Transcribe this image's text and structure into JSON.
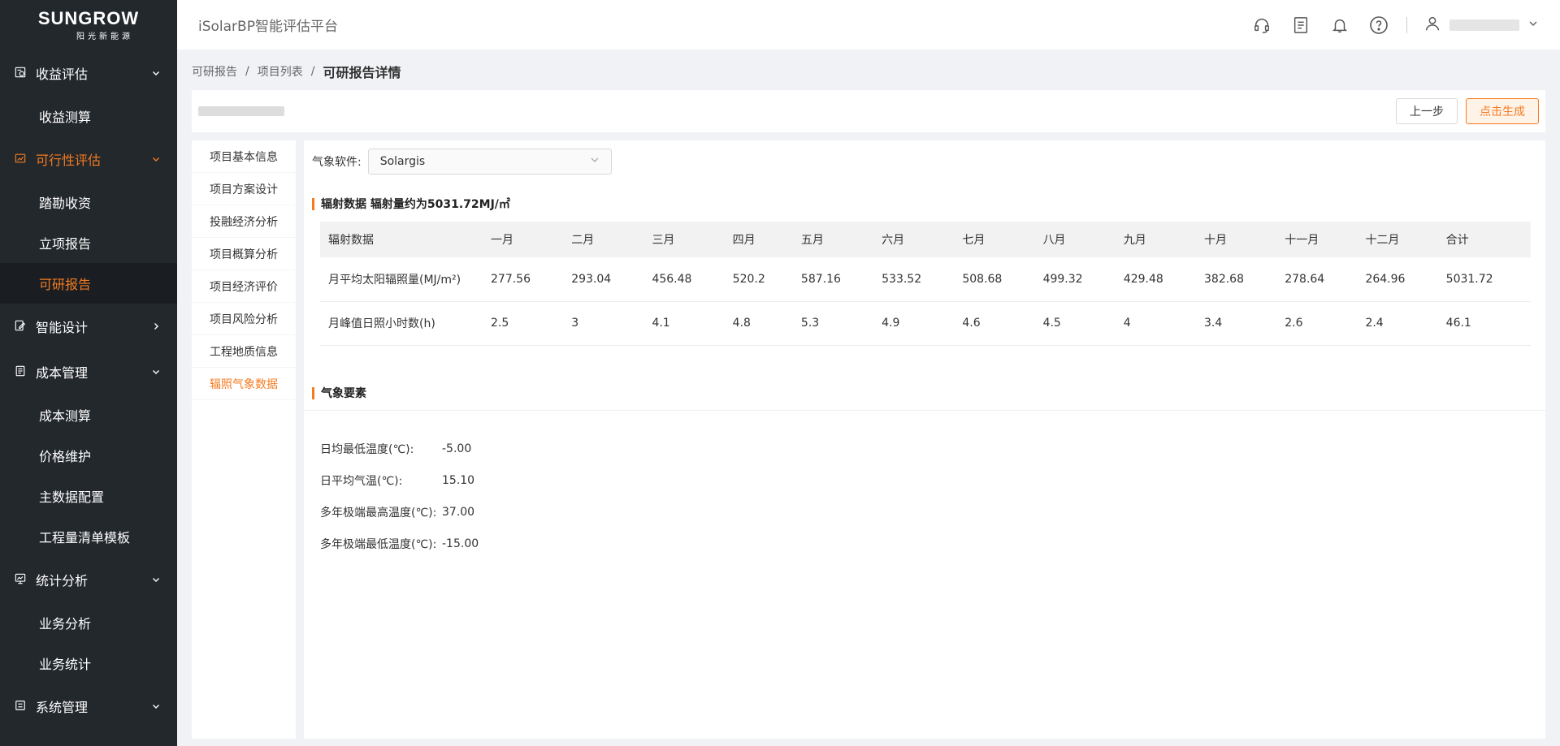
{
  "logo": {
    "brand": "SUNGROW",
    "sub": "阳光新能源"
  },
  "header": {
    "app_title": "iSolarBP智能评估平台"
  },
  "sidebar": {
    "groups": [
      {
        "label": "收益评估",
        "icon": "revenue-icon",
        "arrow": "down",
        "items": [
          "收益测算"
        ]
      },
      {
        "label": "可行性评估",
        "icon": "feasibility-icon",
        "arrow": "down",
        "active": true,
        "items": [
          "踏勘收资",
          "立项报告",
          "可研报告"
        ]
      },
      {
        "label": "智能设计",
        "icon": "design-icon",
        "arrow": "right",
        "items": []
      },
      {
        "label": "成本管理",
        "icon": "cost-icon",
        "arrow": "down",
        "items": [
          "成本测算",
          "价格维护",
          "主数据配置",
          "工程量清单模板"
        ]
      },
      {
        "label": "统计分析",
        "icon": "stats-icon",
        "arrow": "down",
        "items": [
          "业务分析",
          "业务统计"
        ]
      },
      {
        "label": "系统管理",
        "icon": "system-icon",
        "arrow": "down",
        "items": []
      }
    ],
    "selected_item": "可研报告"
  },
  "breadcrumb": {
    "level1": "可研报告",
    "level2": "项目列表",
    "current": "可研报告详情",
    "sep": "/"
  },
  "actions": {
    "prev_label": "上一步",
    "generate_label": "点击生成"
  },
  "tabs": [
    "项目基本信息",
    "项目方案设计",
    "投融经济分析",
    "项目概算分析",
    "项目经济评价",
    "项目风险分析",
    "工程地质信息",
    "辐照气象数据"
  ],
  "active_tab": "辐照气象数据",
  "weather_software": {
    "label": "气象软件:",
    "value": "Solargis"
  },
  "radiation": {
    "title": "辐射数据 辐射量约为5031.72MJ/㎡",
    "headers": [
      "辐射数据",
      "一月",
      "二月",
      "三月",
      "四月",
      "五月",
      "六月",
      "七月",
      "八月",
      "九月",
      "十月",
      "十一月",
      "十二月",
      "合计"
    ],
    "rows": [
      [
        "月平均太阳辐照量(MJ/m²)",
        "277.56",
        "293.04",
        "456.48",
        "520.2",
        "587.16",
        "533.52",
        "508.68",
        "499.32",
        "429.48",
        "382.68",
        "278.64",
        "264.96",
        "5031.72"
      ],
      [
        "月峰值日照小时数(h)",
        "2.5",
        "3",
        "4.1",
        "4.8",
        "5.3",
        "4.9",
        "4.6",
        "4.5",
        "4",
        "3.4",
        "2.6",
        "2.4",
        "46.1"
      ]
    ]
  },
  "meteorology": {
    "title": "气象要素",
    "items": [
      {
        "label": "日均最低温度(℃):",
        "value": "-5.00"
      },
      {
        "label": "日平均气温(℃):",
        "value": "15.10"
      },
      {
        "label": "多年极端最高温度(℃):",
        "value": "37.00"
      },
      {
        "label": "多年极端最低温度(℃):",
        "value": "-15.00"
      }
    ]
  },
  "colors": {
    "accent": "#f47b20",
    "sidebar_bg": "#23282d"
  }
}
